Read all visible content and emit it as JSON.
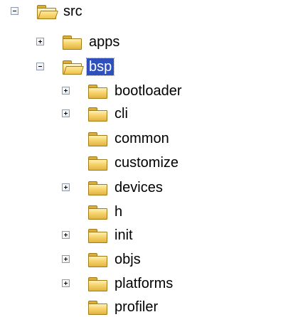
{
  "tree": {
    "root": {
      "label": "src"
    },
    "level1": [
      {
        "label": "apps"
      },
      {
        "label": "bsp"
      }
    ],
    "bsp_children": [
      {
        "label": "bootloader"
      },
      {
        "label": "cli"
      },
      {
        "label": "common"
      },
      {
        "label": "customize"
      },
      {
        "label": "devices"
      },
      {
        "label": "h"
      },
      {
        "label": "init"
      },
      {
        "label": "objs"
      },
      {
        "label": "platforms"
      },
      {
        "label": "profiler"
      }
    ]
  },
  "icons": {
    "folder_closed": "folder-closed-icon",
    "folder_open": "folder-open-icon",
    "expand": "expand-plus-icon",
    "collapse": "collapse-minus-icon"
  },
  "colors": {
    "selection_bg": "#2f4fbd",
    "selection_text": "#ffffff",
    "folder": "#f6d36a",
    "expander_border": "#8c9aaf"
  }
}
